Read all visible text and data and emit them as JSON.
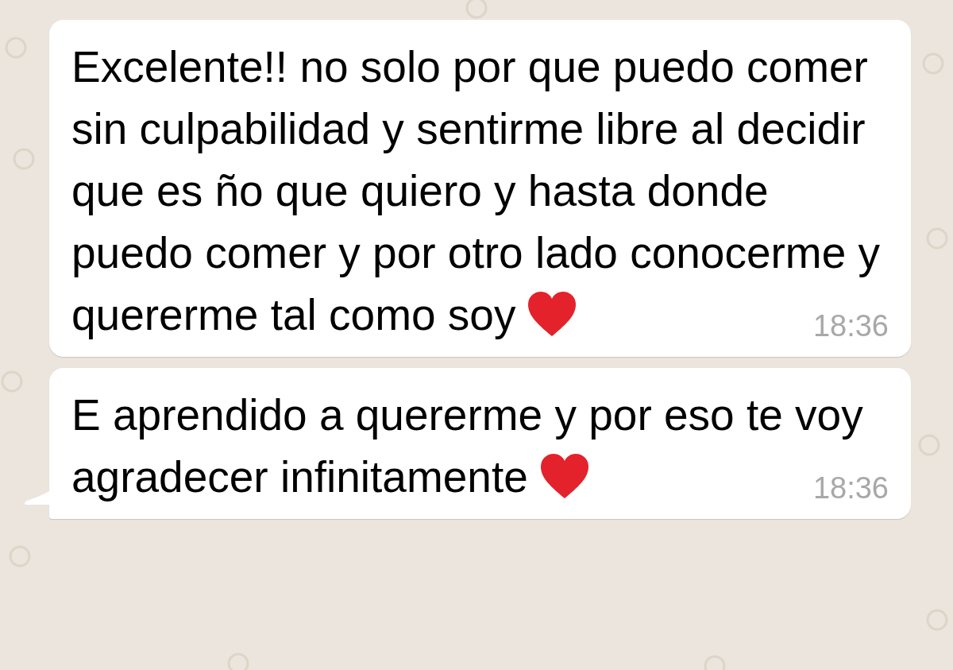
{
  "messages": [
    {
      "text": "Excelente!! no solo por que puedo comer sin culpabilidad y sentirme libre al decidir  que es ño que quiero y hasta donde puedo comer y por otro lado conocerme y quererme tal como soy",
      "time": "18:36",
      "tail": false
    },
    {
      "text": "E aprendido a quererme y por eso te voy agradecer infinitamente",
      "time": "18:36",
      "tail": true
    }
  ]
}
